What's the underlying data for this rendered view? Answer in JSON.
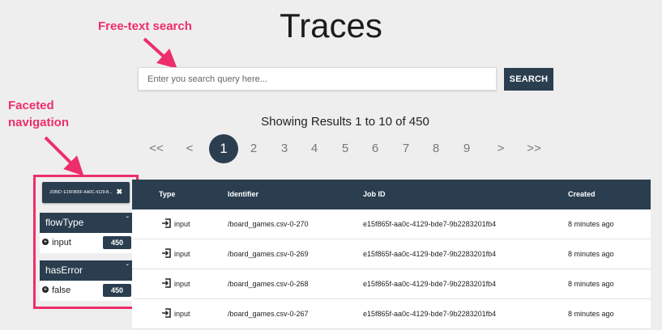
{
  "page": {
    "title": "Traces"
  },
  "annotations": {
    "search_note": "Free-text search",
    "facet_note_line1": "Faceted",
    "facet_note_line2": "navigation",
    "color": "#ee2e6a"
  },
  "search": {
    "placeholder": "Enter you search query here...",
    "button_label": "SEARCH"
  },
  "results": {
    "summary": "Showing Results 1 to 10 of 450"
  },
  "pagination": {
    "first": "<<",
    "prev": "<",
    "pages": [
      "1",
      "2",
      "3",
      "4",
      "5",
      "6",
      "7",
      "8",
      "9"
    ],
    "active_page": "1",
    "next": ">",
    "last": ">>"
  },
  "facets": {
    "active_filter": {
      "label": "JOBID: E15F865F-AA0C-4129-B...",
      "remove_icon": "close-icon"
    },
    "groups": [
      {
        "title": "flowType",
        "chevron": "chevron-down-icon",
        "option": {
          "label": "input",
          "count": "450",
          "icon": "plus-icon"
        }
      },
      {
        "title": "hasError",
        "chevron": "chevron-down-icon",
        "option": {
          "label": "false",
          "count": "450",
          "icon": "plus-icon"
        }
      }
    ]
  },
  "table": {
    "columns": {
      "type": "Type",
      "identifier": "Identifier",
      "job_id": "Job ID",
      "created": "Created"
    },
    "rows": [
      {
        "type": "input",
        "type_icon": "sign-in-icon",
        "identifier": "/board_games.csv-0-270",
        "job_id": "e15f865f-aa0c-4129-bde7-9b2283201fb4",
        "created": "8 minutes ago"
      },
      {
        "type": "input",
        "type_icon": "sign-in-icon",
        "identifier": "/board_games.csv-0-269",
        "job_id": "e15f865f-aa0c-4129-bde7-9b2283201fb4",
        "created": "8 minutes ago"
      },
      {
        "type": "input",
        "type_icon": "sign-in-icon",
        "identifier": "/board_games.csv-0-268",
        "job_id": "e15f865f-aa0c-4129-bde7-9b2283201fb4",
        "created": "8 minutes ago"
      },
      {
        "type": "input",
        "type_icon": "sign-in-icon",
        "identifier": "/board_games.csv-0-267",
        "job_id": "e15f865f-aa0c-4129-bde7-9b2283201fb4",
        "created": "8 minutes ago"
      }
    ]
  },
  "colors": {
    "primary": "#2b3e50",
    "background": "#eeeeee",
    "accent": "#ee2e6a"
  }
}
